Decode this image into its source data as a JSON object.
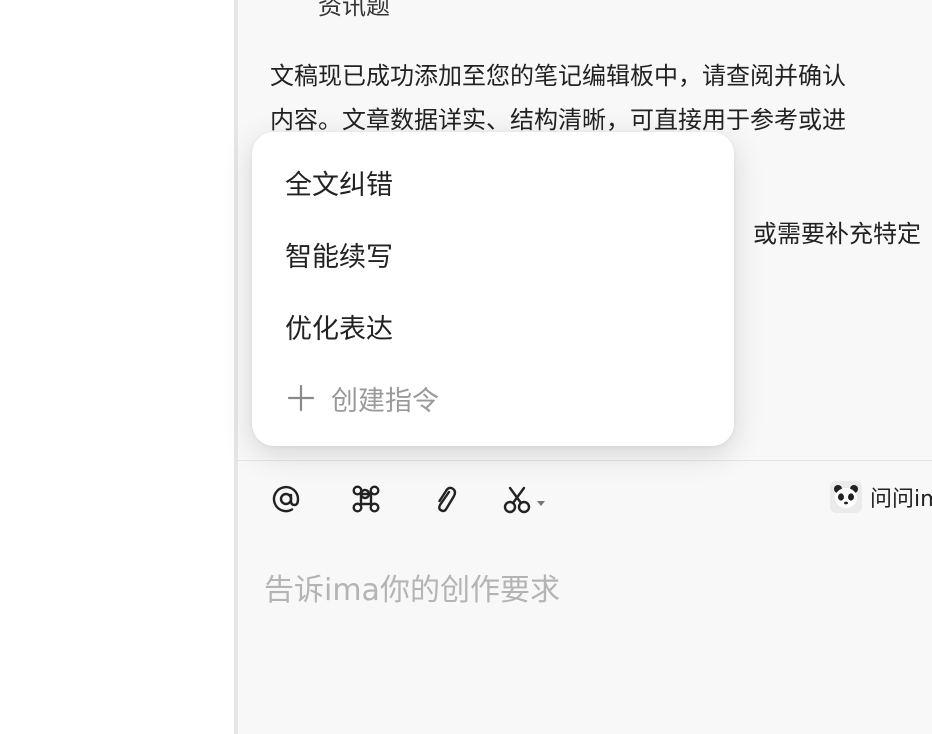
{
  "chat": {
    "partial_line": "资讯题",
    "paragraph_line1": "文稿现已成功添加至您的笔记编辑板中，请查阅并确认",
    "paragraph_line2": "内容。文章数据详实、结构清晰，可直接用于参考或进",
    "paragraph2_fragment": "或需要补充特定"
  },
  "popup_menu": {
    "items": [
      {
        "label": "全文纠错"
      },
      {
        "label": "智能续写"
      },
      {
        "label": "优化表达"
      }
    ],
    "create_label": "创建指令"
  },
  "toolbar": {
    "icons": [
      "at-icon",
      "command-icon",
      "attachment-icon",
      "scissors-icon"
    ],
    "ask_label": "问问ima"
  },
  "input": {
    "placeholder": "告诉ima你的创作要求"
  }
}
